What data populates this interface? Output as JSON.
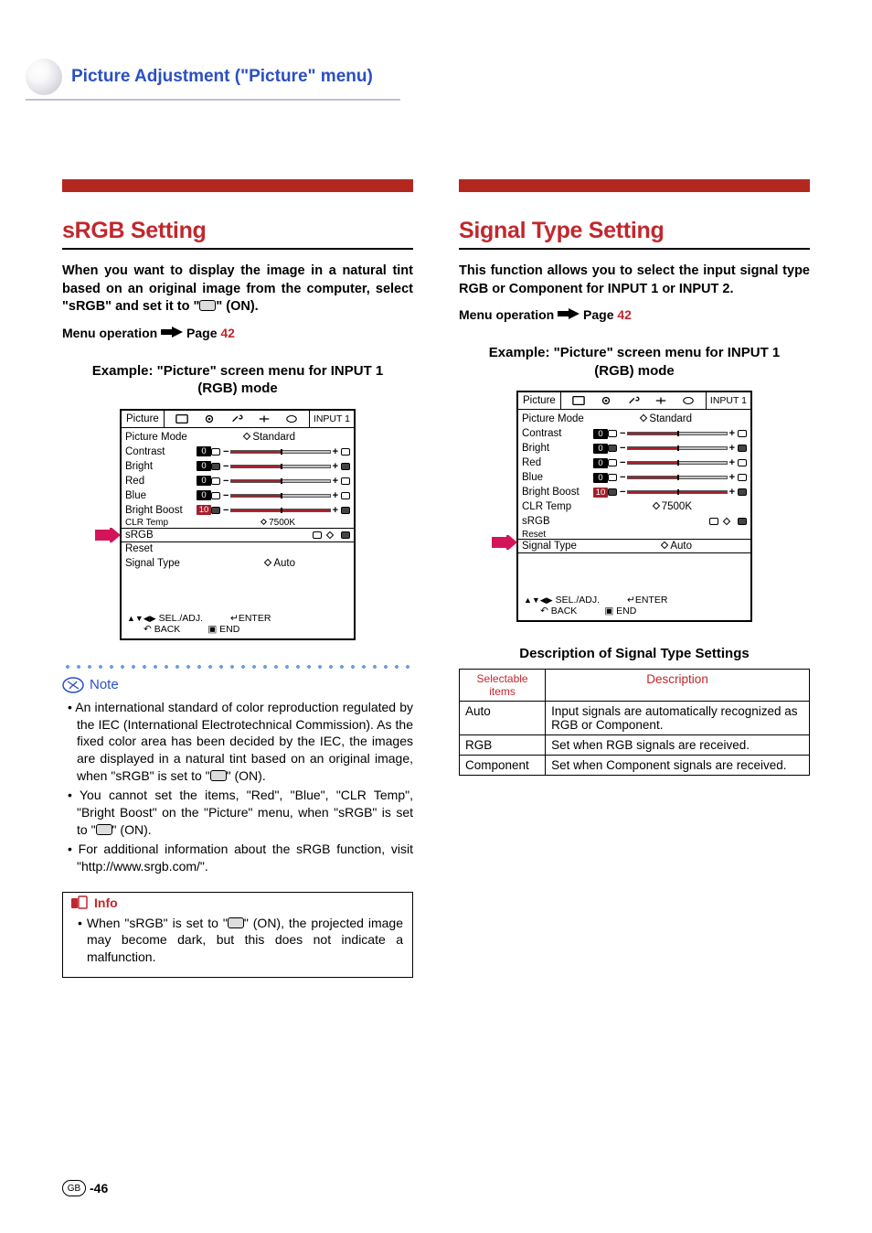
{
  "header": {
    "title": "Picture Adjustment (\"Picture\" menu)"
  },
  "left": {
    "title": "sRGB Setting",
    "intro": "When you want to display the image in a natural tint based on an original image from the computer, select \"sRGB\" and set it to \"",
    "intro_suffix": "\" (ON).",
    "menu_op_prefix": "Menu operation",
    "menu_op_page_label": "Page",
    "menu_op_page": "42",
    "example": "Example: \"Picture\" screen menu for INPUT 1 (RGB) mode",
    "osd": {
      "tab": "Picture",
      "input": "INPUT 1",
      "picture_mode_label": "Picture Mode",
      "picture_mode_value": "Standard",
      "rows": [
        {
          "label": "Contrast",
          "value": "0"
        },
        {
          "label": "Bright",
          "value": "0"
        },
        {
          "label": "Red",
          "value": "0"
        },
        {
          "label": "Blue",
          "value": "0"
        },
        {
          "label": "Bright Boost",
          "value": "10"
        }
      ],
      "clr_temp_label": "CLR Temp",
      "clr_temp_value": "7500K",
      "srgb_label": "sRGB",
      "reset_label": "Reset",
      "signal_type_label": "Signal Type",
      "signal_type_value": "Auto",
      "footer_sel": "SEL./ADJ.",
      "footer_enter": "ENTER",
      "footer_back": "BACK",
      "footer_end": "END"
    },
    "note_label": "Note",
    "notes": [
      "An international standard of color reproduction regulated by the IEC (International Electrotechnical Commission). As the fixed color area has been decided by the IEC, the images are displayed in a natural tint based on an original image, when \"sRGB\" is set to \"",
      "You cannot set the items, \"Red\", \"Blue\", \"CLR Temp\", \"Bright Boost\" on the \"Picture\" menu, when \"sRGB\" is set to \"",
      "For additional information about the sRGB function, visit \"http://www.srgb.com/\"."
    ],
    "note_on_suffix": "\" (ON).",
    "info_label": "Info",
    "info_text_prefix": "When \"sRGB\" is set to \"",
    "info_text_suffix": "\" (ON), the projected image may become dark, but this does not indicate a malfunction."
  },
  "right": {
    "title": "Signal Type Setting",
    "intro": "This function allows you to select the input signal type RGB or Component for INPUT 1 or INPUT 2.",
    "menu_op_prefix": "Menu operation",
    "menu_op_page_label": "Page",
    "menu_op_page": "42",
    "example": "Example: \"Picture\" screen menu for INPUT 1 (RGB) mode",
    "osd": {
      "tab": "Picture",
      "input": "INPUT 1",
      "picture_mode_label": "Picture Mode",
      "picture_mode_value": "Standard",
      "rows": [
        {
          "label": "Contrast",
          "value": "0"
        },
        {
          "label": "Bright",
          "value": "0"
        },
        {
          "label": "Red",
          "value": "0"
        },
        {
          "label": "Blue",
          "value": "0"
        },
        {
          "label": "Bright Boost",
          "value": "10"
        }
      ],
      "clr_temp_label": "CLR Temp",
      "clr_temp_value": "7500K",
      "srgb_label": "sRGB",
      "reset_label": "Reset",
      "signal_type_label": "Signal Type",
      "signal_type_value": "Auto",
      "footer_sel": "SEL./ADJ.",
      "footer_enter": "ENTER",
      "footer_back": "BACK",
      "footer_end": "END"
    },
    "table_title": "Description of Signal Type Settings",
    "table": {
      "head_items": "Selectable items",
      "head_desc": "Description",
      "rows": [
        {
          "item": "Auto",
          "desc": "Input signals are automatically recognized as RGB or Component."
        },
        {
          "item": "RGB",
          "desc": "Set when RGB signals are received."
        },
        {
          "item": "Component",
          "desc": "Set when Component signals are received."
        }
      ]
    }
  },
  "footer": {
    "region": "GB",
    "page": "-46"
  }
}
